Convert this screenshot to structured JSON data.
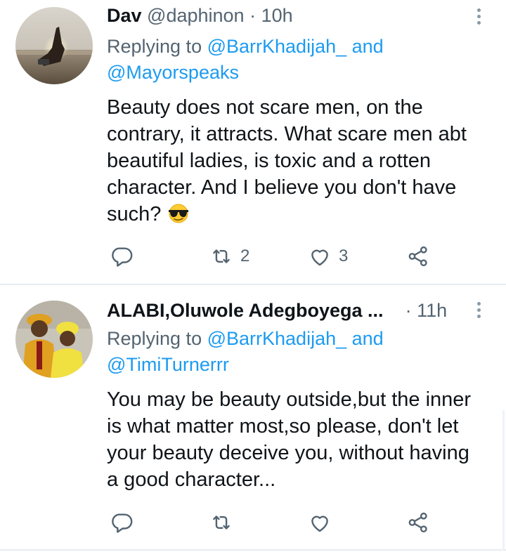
{
  "tweets": [
    {
      "name": "Dav",
      "handle": "@daphinon",
      "dot": "·",
      "time": "10h",
      "replying_prefix": "Replying to ",
      "mention1": "@BarrKhadijah_",
      "and": " and",
      "mention2": "@Mayorspeaks",
      "text_lines": [
        "Beauty does not scare men, on the",
        "contrary, it attracts. What scare men abt",
        "beautiful ladies, is toxic and a rotten",
        "character. And I believe you don't have",
        "such?"
      ],
      "emoji": "smiling-face-with-sunglasses",
      "retweet_count": "2",
      "like_count": "3"
    },
    {
      "name": "ALABI,Oluwole Adegboyega ...",
      "handle": "",
      "dot": "·",
      "time": "11h",
      "replying_prefix": "Replying to ",
      "mention1": "@BarrKhadijah_",
      "and": " and",
      "mention2": "@TimiTurnerrr",
      "text_lines": [
        "You may be beauty outside,but the inner",
        "is what matter most,so please, don't let",
        "your beauty deceive you, without having",
        "a good character..."
      ],
      "retweet_count": "",
      "like_count": ""
    }
  ],
  "colors": {
    "link": "#1d9bf0",
    "secondary": "#536471",
    "icon": "#536471",
    "divider": "#e6ecf0"
  }
}
